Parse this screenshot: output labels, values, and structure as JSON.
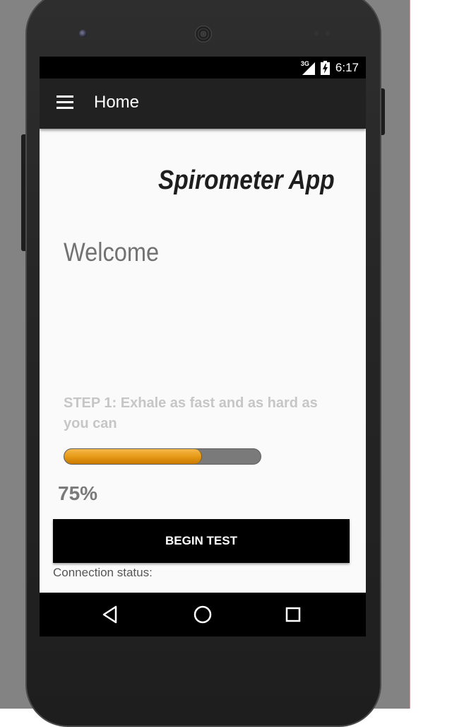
{
  "status_bar": {
    "network_label": "3G",
    "signal_icon": "signal-icon",
    "battery_icon": "battery-charging-icon",
    "time": "6:17"
  },
  "app_bar": {
    "menu_icon": "hamburger-menu-icon",
    "title": "Home"
  },
  "main": {
    "app_name": "Spirometer App",
    "welcome": "Welcome",
    "step_instruction": "STEP 1: Exhale as fast and as hard as you can",
    "progress_label": "75%",
    "progress_fraction": 0.7,
    "begin_button_label": "BEGIN TEST",
    "connection_status": "Connection status:"
  },
  "nav_bar": {
    "back_icon": "back-triangle-icon",
    "home_icon": "home-circle-icon",
    "recents_icon": "recents-square-icon"
  },
  "colors": {
    "app_bar": "#212121",
    "status_bar": "#000000",
    "progress_fill": "#e79a17",
    "progress_track": "#7a7a7a",
    "button": "#000000",
    "content_bg": "#fafafa"
  }
}
